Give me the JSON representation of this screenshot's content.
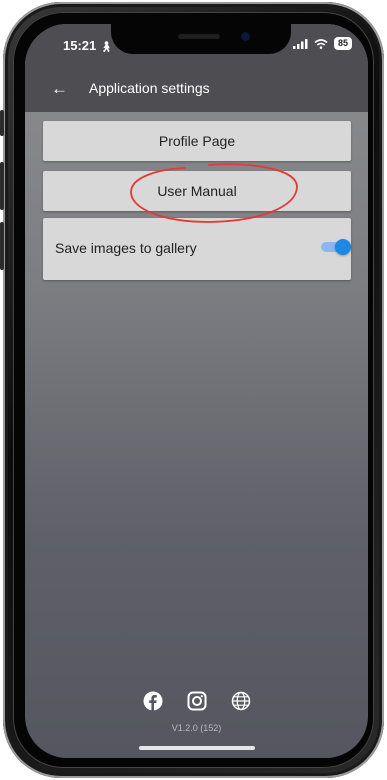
{
  "status_bar": {
    "time": "15:21",
    "battery": "85"
  },
  "app_bar": {
    "back_icon": "arrow-left-icon",
    "title": "Application settings"
  },
  "buttons": [
    {
      "label": "Profile Page"
    },
    {
      "label": "User Manual"
    }
  ],
  "settings": {
    "save_images": {
      "label": "Save images to gallery",
      "enabled": true
    }
  },
  "annotation": {
    "shape": "hand-drawn-circle",
    "color": "#e53935",
    "target": "User Manual"
  },
  "footer": {
    "icons": [
      "facebook-icon",
      "instagram-icon",
      "globe-icon"
    ],
    "version": "V1.2.0 (152)"
  },
  "colors": {
    "accent": "#1e88e5",
    "annotation": "#e53935"
  }
}
